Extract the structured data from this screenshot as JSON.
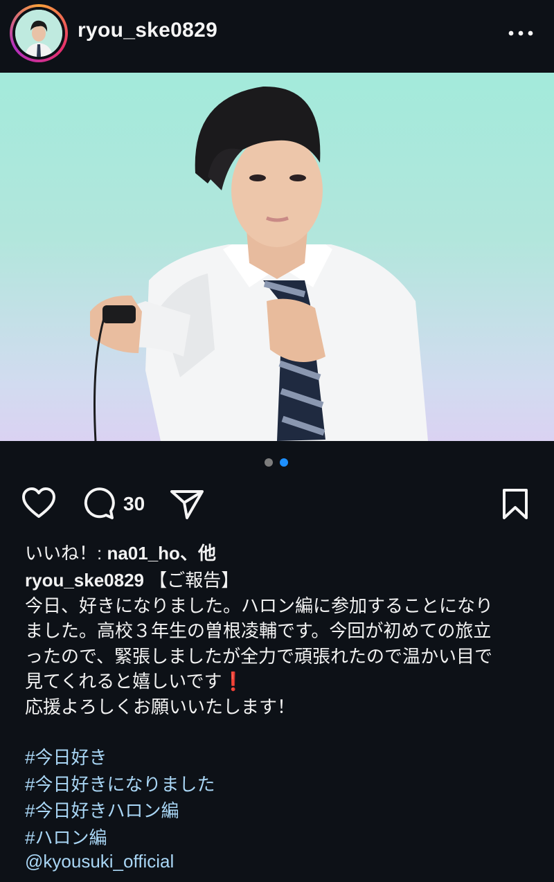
{
  "post": {
    "username": "ryou_ske0829",
    "carousel": {
      "count": 2,
      "active_index": 1
    },
    "actions": {
      "comment_count": "30"
    },
    "likes": {
      "prefix": "いいね！: ",
      "user": "na01_ho",
      "suffix": "、他"
    },
    "caption": {
      "user": "ryou_ske0829",
      "title": "【ご報告】",
      "lines": [
        "今日、好きになりました。ハロン編に参加することになり",
        "ました。高校３年生の曽根凌輔です。今回が初めての旅立",
        "ったので、緊張しましたが全力で頑張れたので温かい目で",
        "見てくれると嬉しいです❗️",
        "応援よろしくお願いいたします！"
      ]
    },
    "hashtags": [
      " #今日好き",
      " #今日好きになりました",
      " #今日好きハロン編",
      " #ハロン編"
    ],
    "mention": "@kyousuki_official"
  },
  "colors": {
    "background": "#0d1117",
    "text": "#f2f2f2",
    "link": "#a9d6f5",
    "dot_active": "#1e90ff",
    "dot_inactive": "#7d7d7d"
  },
  "icons": {
    "more": "more-horizontal-icon",
    "like": "heart-icon",
    "comment": "comment-bubble-icon",
    "share": "paper-plane-icon",
    "save": "bookmark-icon"
  }
}
